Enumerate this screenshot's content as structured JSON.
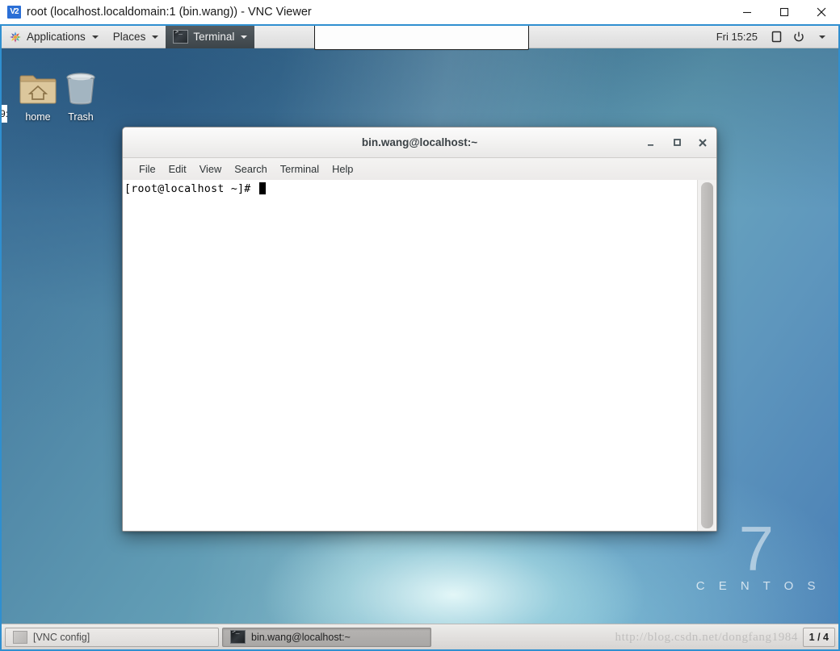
{
  "vnc_window": {
    "icon": "vnc-logo-icon",
    "icon_text": "V2",
    "title": "root (localhost.localdomain:1 (bin.wang)) - VNC Viewer",
    "buttons": {
      "minimize": "minimize-icon",
      "maximize": "maximize-icon",
      "close": "close-icon"
    }
  },
  "gnome_panel": {
    "applications_label": "Applications",
    "places_label": "Places",
    "active_app_label": "Terminal",
    "clock": "Fri 15:25",
    "screen_icon": "screen-icon",
    "power_icon": "power-icon"
  },
  "desktop": {
    "icons": [
      {
        "name": "home",
        "label": "home",
        "glyph": "home-folder-icon"
      },
      {
        "name": "trash",
        "label": "Trash",
        "glyph": "trash-can-icon"
      }
    ],
    "branding": {
      "number": "7",
      "word": "C E N T O S"
    },
    "edge_artifact": "9:"
  },
  "terminal": {
    "title": "bin.wang@localhost:~",
    "menu": [
      {
        "label": "File"
      },
      {
        "label": "Edit"
      },
      {
        "label": "View"
      },
      {
        "label": "Search"
      },
      {
        "label": "Terminal"
      },
      {
        "label": "Help"
      }
    ],
    "buttons": {
      "minimize": "minimize-icon",
      "maximize": "maximize-icon",
      "close": "close-icon"
    },
    "prompt": "[root@localhost ~]# "
  },
  "taskbar": {
    "tasks": [
      {
        "label": "[VNC config]",
        "icon": "window-icon",
        "active": false
      },
      {
        "label": "bin.wang@localhost:~",
        "icon": "terminal-icon",
        "active": true
      }
    ],
    "workspace": "1 / 4"
  },
  "watermark": {
    "text": "http://blog.csdn.net/dongfang1984"
  },
  "colors": {
    "vnc_accent": "#2b6fd6",
    "panel_active": "#3c4449",
    "desktop_blue": "#4f86a6",
    "terminal_bg": "#ffffff"
  }
}
